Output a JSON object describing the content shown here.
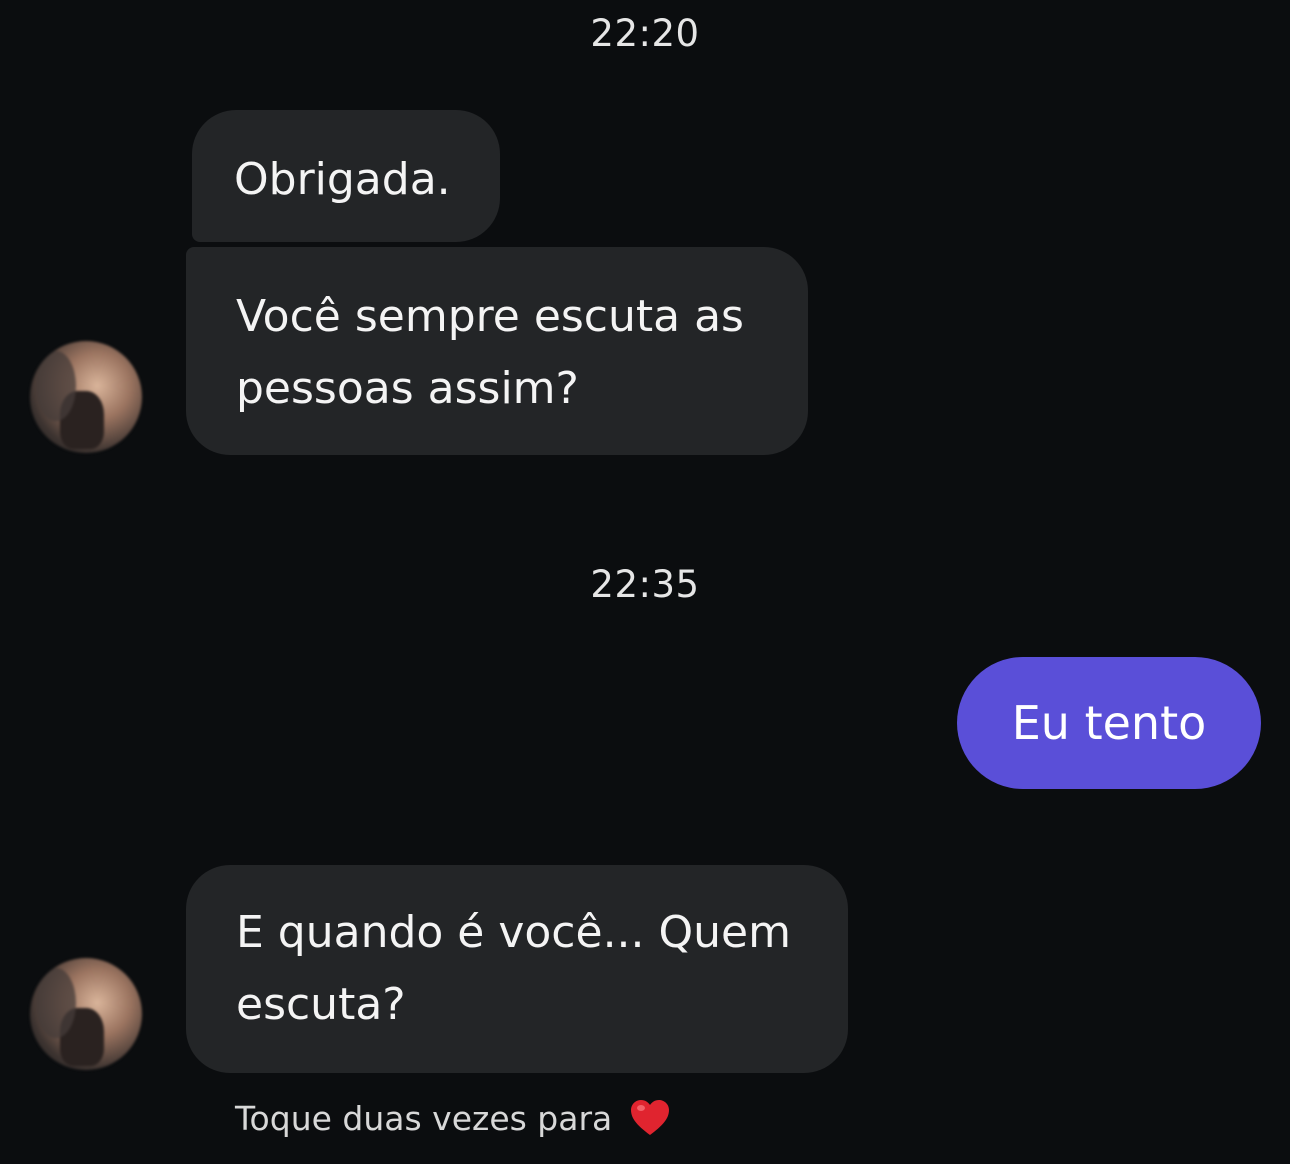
{
  "timestamps": [
    "22:20",
    "22:35"
  ],
  "messages": {
    "m1": "Obrigada.",
    "m2_line1": "Você sempre escuta as",
    "m2_line2": "pessoas assim?",
    "m3": "Eu tento",
    "m4_line1": "E quando é você... Quem",
    "m4_line2": "escuta?"
  },
  "hint": {
    "text": "Toque duas vezes para",
    "icon": "heart-icon"
  },
  "colors": {
    "background": "#0b0d0f",
    "incoming_bubble": "#232527",
    "outgoing_bubble": "#5a4fd8",
    "heart": "#e0242f"
  }
}
